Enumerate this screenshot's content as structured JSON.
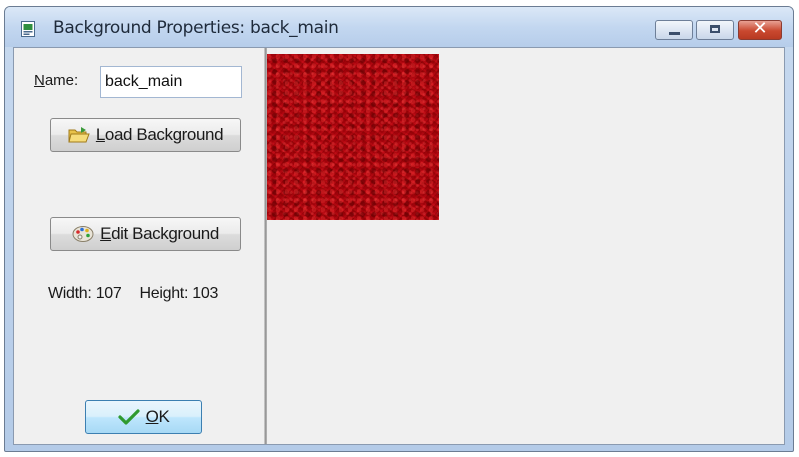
{
  "window": {
    "title": "Background Properties: back_main",
    "close_glyph": "✕"
  },
  "form": {
    "name_label_prefix": "N",
    "name_label_rest": "ame:",
    "name_value": "back_main",
    "load_button_accel": "L",
    "load_button_rest": "oad Background",
    "edit_button_accel": "E",
    "edit_button_rest": "dit Background",
    "width_text": "Width: 107",
    "height_text": "Height: 103",
    "ok_accel": "O",
    "ok_rest": "K"
  },
  "background": {
    "width": 107,
    "height": 103,
    "color": "#b0050d"
  },
  "icons": {
    "app": "background-doc-icon",
    "load": "folder-open-icon",
    "edit": "palette-icon",
    "ok": "checkmark-icon"
  },
  "colors": {
    "ok_check": "#2f9a2f",
    "close_button": "#c9482f"
  }
}
